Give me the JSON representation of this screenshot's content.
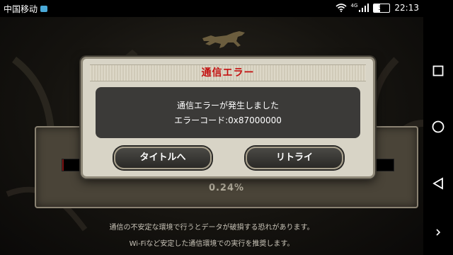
{
  "status_bar": {
    "carrier": "中国移动",
    "network": "4G",
    "battery": "37",
    "battery_level": 0.37,
    "time": "22:13"
  },
  "game": {
    "loading_percent": "0.24%",
    "loading_progress": 0.0024,
    "notice_line1": "通信の不安定な環境で行うとデータが破損する恐れがあります。",
    "notice_line2": "Wi-Fiなど安定した通信環境での実行を推奨します。"
  },
  "dialog": {
    "title": "通信エラー",
    "message_line1": "通信エラーが発生しました",
    "message_line2": "エラーコード:0x87000000",
    "button_title": "タイトルへ",
    "button_retry": "リトライ"
  },
  "nav": {
    "buttons": [
      "recent-apps",
      "home",
      "back",
      "expand"
    ]
  },
  "colors": {
    "dialog_title": "#c41010",
    "progress_fill": "#7a1010",
    "dialog_bg": "#d8d4c6"
  }
}
